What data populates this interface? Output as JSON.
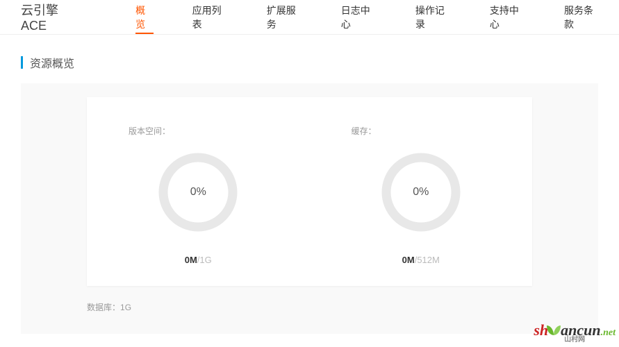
{
  "brand": "云引擎ACE",
  "nav": {
    "items": [
      {
        "label": "概览",
        "active": true
      },
      {
        "label": "应用列表",
        "active": false
      },
      {
        "label": "扩展服务",
        "active": false
      },
      {
        "label": "日志中心",
        "active": false
      },
      {
        "label": "操作记录",
        "active": false
      },
      {
        "label": "支持中心",
        "active": false
      },
      {
        "label": "服务条款",
        "active": false
      }
    ]
  },
  "section_title": "资源概览",
  "chart_data": [
    {
      "type": "pie",
      "title": "版本空间：",
      "center_label": "0%",
      "used_label": "0M",
      "total_label": "/1G",
      "percent": 0
    },
    {
      "type": "pie",
      "title": "缓存：",
      "center_label": "0%",
      "used_label": "0M",
      "total_label": "/512M",
      "percent": 0
    }
  ],
  "info": {
    "db_label": "数据库：",
    "db_value": "1G"
  },
  "watermark": {
    "text_sh": "sh",
    "text_ancun": "ancun",
    "text_net": ".net",
    "sub": "山村网"
  }
}
